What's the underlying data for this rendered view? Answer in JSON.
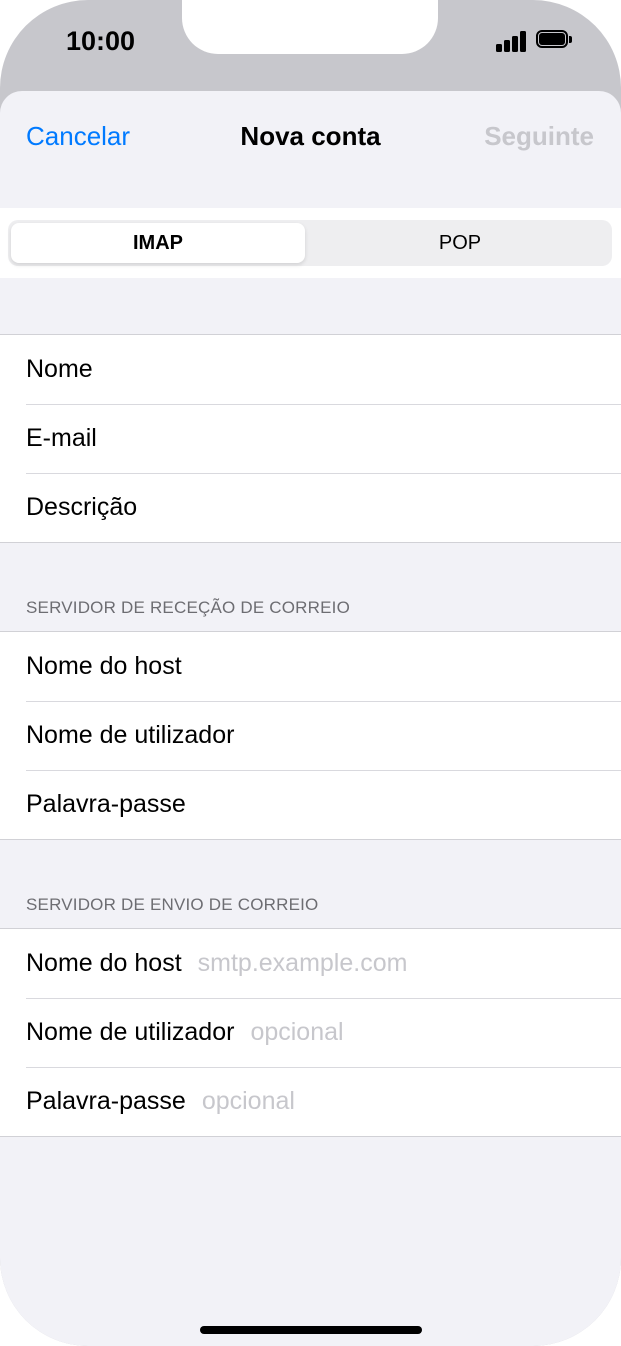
{
  "status_bar": {
    "time": "10:00"
  },
  "navbar": {
    "cancel": "Cancelar",
    "title": "Nova conta",
    "next": "Seguinte"
  },
  "segment": {
    "options": [
      "IMAP",
      "POP"
    ],
    "selected": "IMAP"
  },
  "account": {
    "fields": [
      {
        "label": "Nome"
      },
      {
        "label": "E-mail"
      },
      {
        "label": "Descrição"
      }
    ]
  },
  "incoming": {
    "header": "SERVIDOR DE RECEÇÃO DE CORREIO",
    "fields": [
      {
        "label": "Nome do host"
      },
      {
        "label": "Nome de utilizador"
      },
      {
        "label": "Palavra-passe"
      }
    ]
  },
  "outgoing": {
    "header": "SERVIDOR DE ENVIO DE CORREIO",
    "fields": [
      {
        "label": "Nome do host",
        "placeholder": "smtp.example.com"
      },
      {
        "label": "Nome de utilizador",
        "placeholder": "opcional"
      },
      {
        "label": "Palavra-passe",
        "placeholder": "opcional"
      }
    ]
  }
}
